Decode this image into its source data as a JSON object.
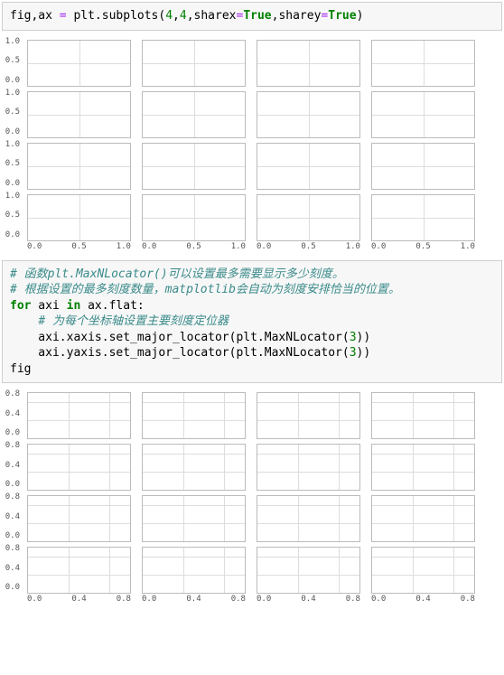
{
  "code1": {
    "tokens": [
      {
        "t": "fig,ax ",
        "c": "plain"
      },
      {
        "t": "=",
        "c": "op"
      },
      {
        "t": " plt.subplots(",
        "c": "plain"
      },
      {
        "t": "4",
        "c": "num"
      },
      {
        "t": ",",
        "c": "plain"
      },
      {
        "t": "4",
        "c": "num"
      },
      {
        "t": ",sharex",
        "c": "plain"
      },
      {
        "t": "=",
        "c": "op"
      },
      {
        "t": "True",
        "c": "bool"
      },
      {
        "t": ",sharey",
        "c": "plain"
      },
      {
        "t": "=",
        "c": "op"
      },
      {
        "t": "True",
        "c": "bool"
      },
      {
        "t": ")",
        "c": "plain"
      }
    ]
  },
  "chart1": {
    "rows": 4,
    "cols": 4,
    "yticks": [
      "1.0",
      "0.5",
      "0.0"
    ],
    "xticks": [
      "0.0",
      "0.5",
      "1.0"
    ],
    "vgrid_pct": [
      50
    ],
    "hgrid_pct": [
      50
    ]
  },
  "code2": {
    "lines": [
      [
        {
          "t": "# 函数plt.MaxNLocator()可以设置最多需要显示多少刻度。",
          "c": "comment"
        }
      ],
      [
        {
          "t": "# 根据设置的最多刻度数量，matplotlib会自动为刻度安排恰当的位置。",
          "c": "comment"
        }
      ],
      [
        {
          "t": "for",
          "c": "kw"
        },
        {
          "t": " axi ",
          "c": "plain"
        },
        {
          "t": "in",
          "c": "kw"
        },
        {
          "t": " ax.flat:",
          "c": "plain"
        }
      ],
      [
        {
          "t": "    ",
          "c": "plain"
        },
        {
          "t": "# 为每个坐标轴设置主要刻度定位器",
          "c": "comment"
        }
      ],
      [
        {
          "t": "    axi.xaxis.set_major_locator(plt.MaxNLocator(",
          "c": "plain"
        },
        {
          "t": "3",
          "c": "num"
        },
        {
          "t": "))",
          "c": "plain"
        }
      ],
      [
        {
          "t": "    axi.yaxis.set_major_locator(plt.MaxNLocator(",
          "c": "plain"
        },
        {
          "t": "3",
          "c": "num"
        },
        {
          "t": "))",
          "c": "plain"
        }
      ],
      [
        {
          "t": "fig",
          "c": "plain"
        }
      ]
    ]
  },
  "chart2": {
    "rows": 4,
    "cols": 4,
    "yticks": [
      "0.8",
      "0.4",
      "0.0"
    ],
    "xticks": [
      "0.0",
      "0.4",
      "0.8"
    ],
    "vgrid_pct": [
      40,
      80
    ],
    "hgrid_pct": [
      20,
      60
    ]
  },
  "chart_data": [
    {
      "type": "line",
      "title": "",
      "grid_layout": "4x4 shared-axis subplots (default ticks)",
      "series": [],
      "xlim": [
        0.0,
        1.0
      ],
      "ylim": [
        0.0,
        1.0
      ],
      "xticks": [
        0.0,
        0.5,
        1.0
      ],
      "yticks": [
        0.0,
        0.5,
        1.0
      ],
      "xlabel": "",
      "ylabel": "",
      "n_rows": 4,
      "n_cols": 4,
      "note": "All 16 subplots empty; sharex=True, sharey=True"
    },
    {
      "type": "line",
      "title": "",
      "grid_layout": "4x4 shared-axis subplots (MaxNLocator(3))",
      "series": [],
      "xlim": [
        0.0,
        1.0
      ],
      "ylim": [
        0.0,
        1.0
      ],
      "xticks": [
        0.0,
        0.4,
        0.8
      ],
      "yticks": [
        0.0,
        0.4,
        0.8
      ],
      "xlabel": "",
      "ylabel": "",
      "n_rows": 4,
      "n_cols": 4,
      "note": "Same figure after applying plt.MaxNLocator(3) to both axes of every subplot"
    }
  ]
}
